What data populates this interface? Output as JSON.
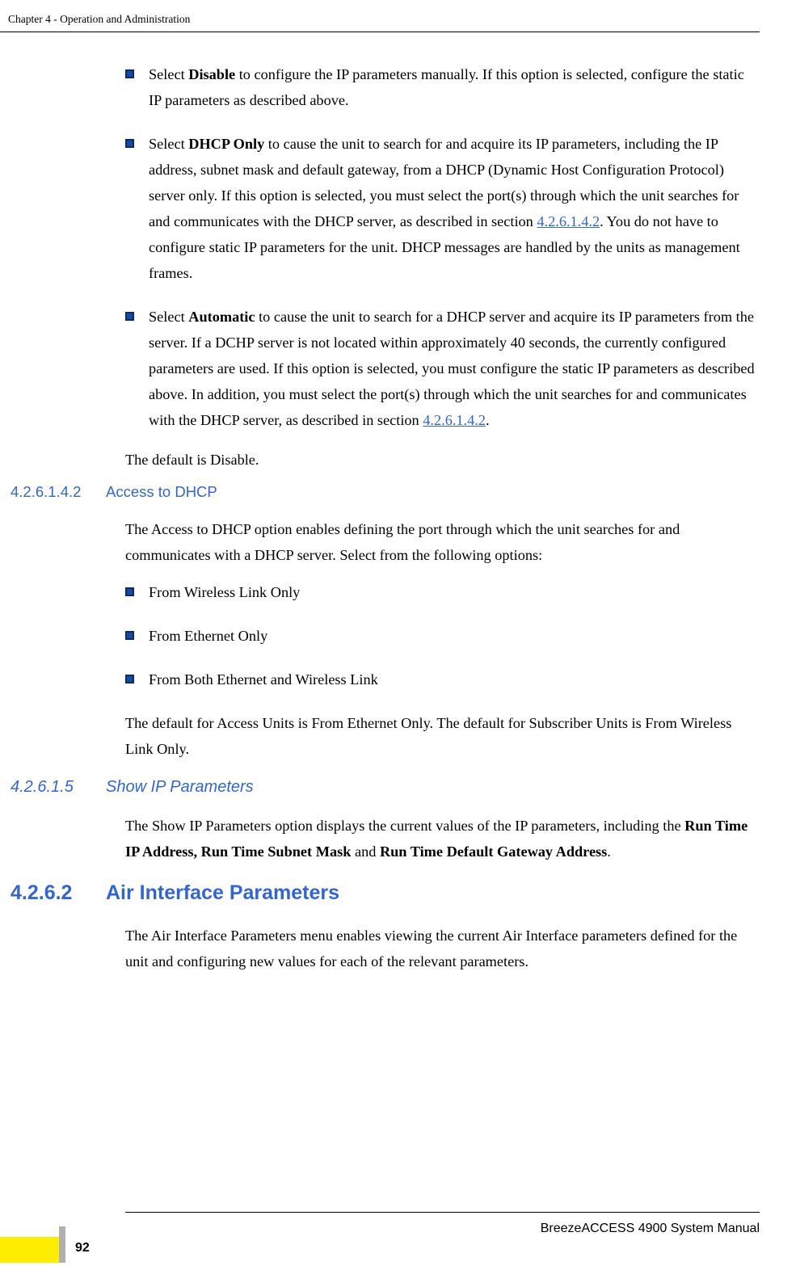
{
  "header": "Chapter 4 - Operation and Administration",
  "bullets": {
    "disable": {
      "prefix": "Select ",
      "bold": "Disable",
      "suffix": " to configure the IP parameters manually. If this option is selected, configure the static IP parameters as described above."
    },
    "dhcp": {
      "prefix": "Select ",
      "bold": "DHCP Only",
      "mid": " to cause the unit to search for and acquire its IP parameters, including the IP address, subnet mask and default gateway, from a DHCP (Dynamic Host Configuration Protocol) server only. If this option is selected, you must select the port(s) through which the unit searches for and communicates with the DHCP server, as described in section ",
      "link": "4.2.6.1.4.2",
      "end": ". You do not have to configure static IP parameters for the unit. DHCP messages are handled by the units as management frames."
    },
    "auto": {
      "prefix": "Select ",
      "bold": "Automatic",
      "mid": " to cause the unit to search for a DHCP server and acquire its IP parameters from the server. If a DCHP server is not located within approximately 40 seconds, the currently configured parameters are used. If this option is selected, you must configure the static IP parameters as described above. In addition, you must select the port(s) through which the unit searches for and communicates with the DHCP server, as described in section ",
      "link": "4.2.6.1.4.2",
      "end": "."
    },
    "default": "The default is Disable."
  },
  "sec1": {
    "num": "4.2.6.1.4.2",
    "title": "Access to DHCP",
    "para": "The Access to DHCP option enables defining the port through which the unit searches for and communicates with a DHCP server. Select from the following options:",
    "opt1": "From Wireless Link Only",
    "opt2": "From Ethernet Only",
    "opt3": "From Both Ethernet and Wireless Link",
    "default": "The default for Access Units is From Ethernet Only. The default for Subscriber Units is From Wireless Link Only."
  },
  "sec2": {
    "num": "4.2.6.1.5",
    "title": "Show IP Parameters",
    "prefix": "The Show IP Parameters option displays the current values of the IP parameters, including the ",
    "bold1": "Run Time IP Address, Run Time Subnet Mask",
    "mid": " and ",
    "bold2": "Run Time Default Gateway Address",
    "end": "."
  },
  "sec3": {
    "num": "4.2.6.2",
    "title": "Air Interface Parameters",
    "para": "The Air Interface Parameters menu enables viewing the current Air Interface parameters defined for the unit and configuring new values for each of the relevant parameters."
  },
  "footer": {
    "manual": "BreezeACCESS 4900 System Manual",
    "page": "92"
  }
}
